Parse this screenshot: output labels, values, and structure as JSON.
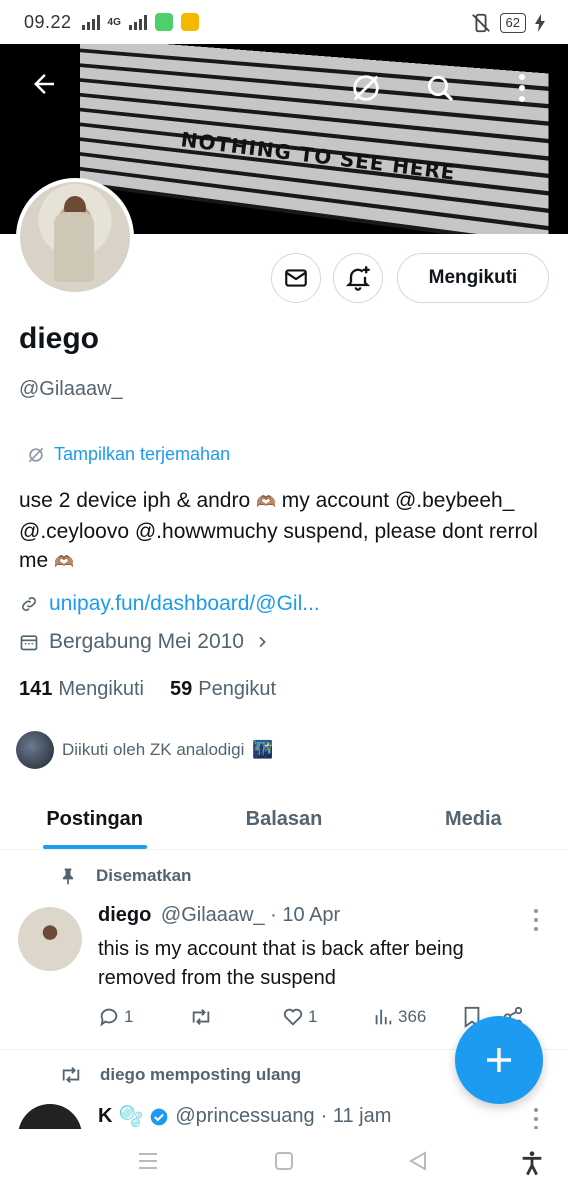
{
  "status_bar": {
    "time": "09.22",
    "network": "4G",
    "battery": "62"
  },
  "banner": {
    "text": "NOTHING TO SEE HERE"
  },
  "header": {
    "back_icon": "arrow-left-icon",
    "translate_icon": "translate-icon",
    "search_icon": "search-icon",
    "more_icon": "more-vertical-icon"
  },
  "profile": {
    "name": "diego",
    "handle": "@Gilaaaw_",
    "translate_label": "Tampilkan terjemahan",
    "bio_part1": "use 2 device iph & andro",
    "bio_part2": "my account @.beybeeh_ @.ceyloovo @.howwmuchy suspend, please dont rerrol me",
    "bio_emoji": "🫶🏽",
    "link": "unipay.fun/dashboard/@Gil...",
    "joined": "Bergabung Mei 2010",
    "following_count": "141",
    "following_label": "Mengikuti",
    "followers_count": "59",
    "followers_label": "Pengikut",
    "followed_by": "Diikuti oleh ZK analodigi",
    "followed_by_emoji": "🌃",
    "follow_button": "Mengikuti"
  },
  "tabs": [
    {
      "label": "Postingan",
      "active": true
    },
    {
      "label": "Balasan",
      "active": false
    },
    {
      "label": "Media",
      "active": false
    }
  ],
  "pinned_post": {
    "pinned_label": "Disematkan",
    "author": "diego",
    "handle": "@Gilaaaw_",
    "date": "· 10 Apr",
    "text": "this is my account that is back after being removed from the suspend",
    "replies": "1",
    "retweets": "",
    "likes": "1",
    "views": "366"
  },
  "repost": {
    "label": "diego memposting ulang",
    "author": "K",
    "author_emoji": "🫧",
    "handle": "@princessuang",
    "time": "· 11 jam"
  },
  "colors": {
    "accent": "#1d9bf0",
    "text": "#0f1419",
    "muted": "#536471",
    "border": "#cfd9de"
  }
}
